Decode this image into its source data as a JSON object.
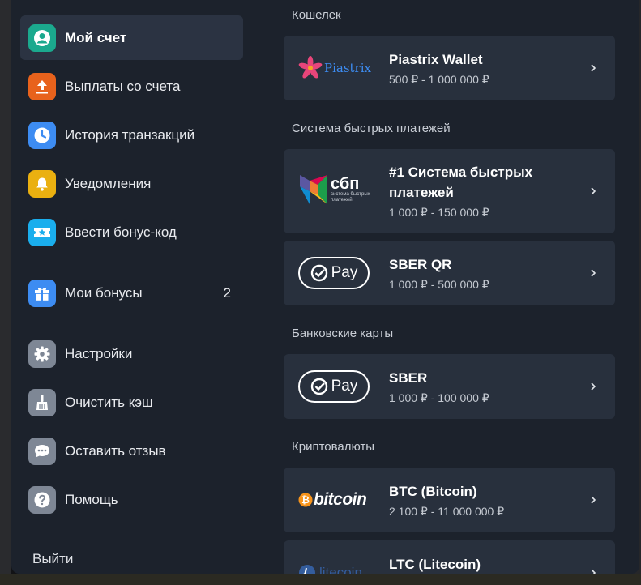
{
  "sidebar": {
    "items": [
      {
        "label": "Мой счет",
        "icon": "user-circle-icon",
        "color": "#1ba98e",
        "active": true
      },
      {
        "label": "Выплаты со счета",
        "icon": "upload-icon",
        "color": "#e8621c"
      },
      {
        "label": "История транзакций",
        "icon": "clock-icon",
        "color": "#3d8cf2"
      },
      {
        "label": "Уведомления",
        "icon": "bell-icon",
        "color": "#eab010"
      },
      {
        "label": "Ввести бонус-код",
        "icon": "ticket-star-icon",
        "color": "#1aaeed"
      },
      {
        "label": "Мои бонусы",
        "icon": "gift-icon",
        "color": "#3d8cf2",
        "count": "2"
      },
      {
        "label": "Настройки",
        "icon": "gear-icon",
        "color": "#7e8795"
      },
      {
        "label": "Очистить кэш",
        "icon": "broom-icon",
        "color": "#7e8795"
      },
      {
        "label": "Оставить отзыв",
        "icon": "chat-bubble-icon",
        "color": "#7e8795"
      },
      {
        "label": "Помощь",
        "icon": "question-icon",
        "color": "#7e8795"
      }
    ],
    "logout_label": "Выйти"
  },
  "main": {
    "sections": [
      {
        "title": "Кошелек",
        "cards": [
          {
            "title": "Piastrix Wallet",
            "range": "500 ₽ - 1 000 000 ₽",
            "logo": "piastrix-logo",
            "logo_text": "Piastrix"
          }
        ]
      },
      {
        "title": "Система быстрых платежей",
        "cards": [
          {
            "title": "#1 Система быстрых платежей",
            "range": "1 000 ₽ - 150 000 ₽",
            "logo": "sbp-logo",
            "logo_text": "сбп",
            "logo_subtext": "система быстрых платежей"
          },
          {
            "title": "SBER QR",
            "range": "1 000 ₽ - 500 000 ₽",
            "logo": "sber-pay-logo",
            "logo_text": "Pay"
          }
        ]
      },
      {
        "title": "Банковские карты",
        "cards": [
          {
            "title": "SBER",
            "range": "1 000 ₽ - 100 000 ₽",
            "logo": "sber-pay-logo",
            "logo_text": "Pay"
          }
        ]
      },
      {
        "title": "Криптовалюты",
        "cards": [
          {
            "title": "BTC (Bitcoin)",
            "range": "2 100 ₽ - 11 000 000 ₽",
            "logo": "bitcoin-logo",
            "logo_text": "bitcoin"
          },
          {
            "title": "LTC (Litecoin)",
            "range": "",
            "logo": "litecoin-logo",
            "logo_text": "litecoin"
          }
        ]
      }
    ]
  }
}
